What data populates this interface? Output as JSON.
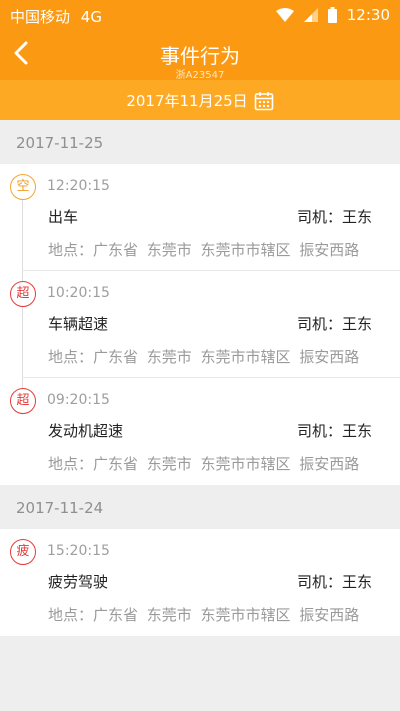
{
  "status_bar": {
    "carrier": "中国移动",
    "network": "4G",
    "time": "12:30"
  },
  "header": {
    "title": "事件行为",
    "subtitle": "浙A23547"
  },
  "date_selector": {
    "date": "2017年11月25日"
  },
  "groups": [
    {
      "date": "2017-11-25",
      "events": [
        {
          "badge": "空",
          "time": "12:20:15",
          "type": "出车",
          "driver": "司机：王东",
          "location": "地点：广东省 东莞市 东莞市市辖区 振安西路",
          "badge_color": "#f09a1f"
        },
        {
          "badge": "超",
          "time": "10:20:15",
          "type": "车辆超速",
          "driver": "司机：王东",
          "location": "地点：广东省 东莞市 东莞市市辖区 振安西路",
          "badge_color": "#e43a3a"
        },
        {
          "badge": "超",
          "time": "09:20:15",
          "type": "发动机超速",
          "driver": "司机：王东",
          "location": "地点：广东省 东莞市 东莞市市辖区 振安西路",
          "badge_color": "#e43a3a"
        }
      ]
    },
    {
      "date": "2017-11-24",
      "events": [
        {
          "badge": "疲",
          "time": "15:20:15",
          "type": "疲劳驾驶",
          "driver": "司机：王东",
          "location": "地点：广东省 东莞市 东莞市市辖区 振安西路",
          "badge_color": "#e43a3a"
        }
      ]
    }
  ],
  "colors": {
    "primary": "#fb9a12",
    "date_bar": "#fda923",
    "background": "#eeeeee"
  }
}
